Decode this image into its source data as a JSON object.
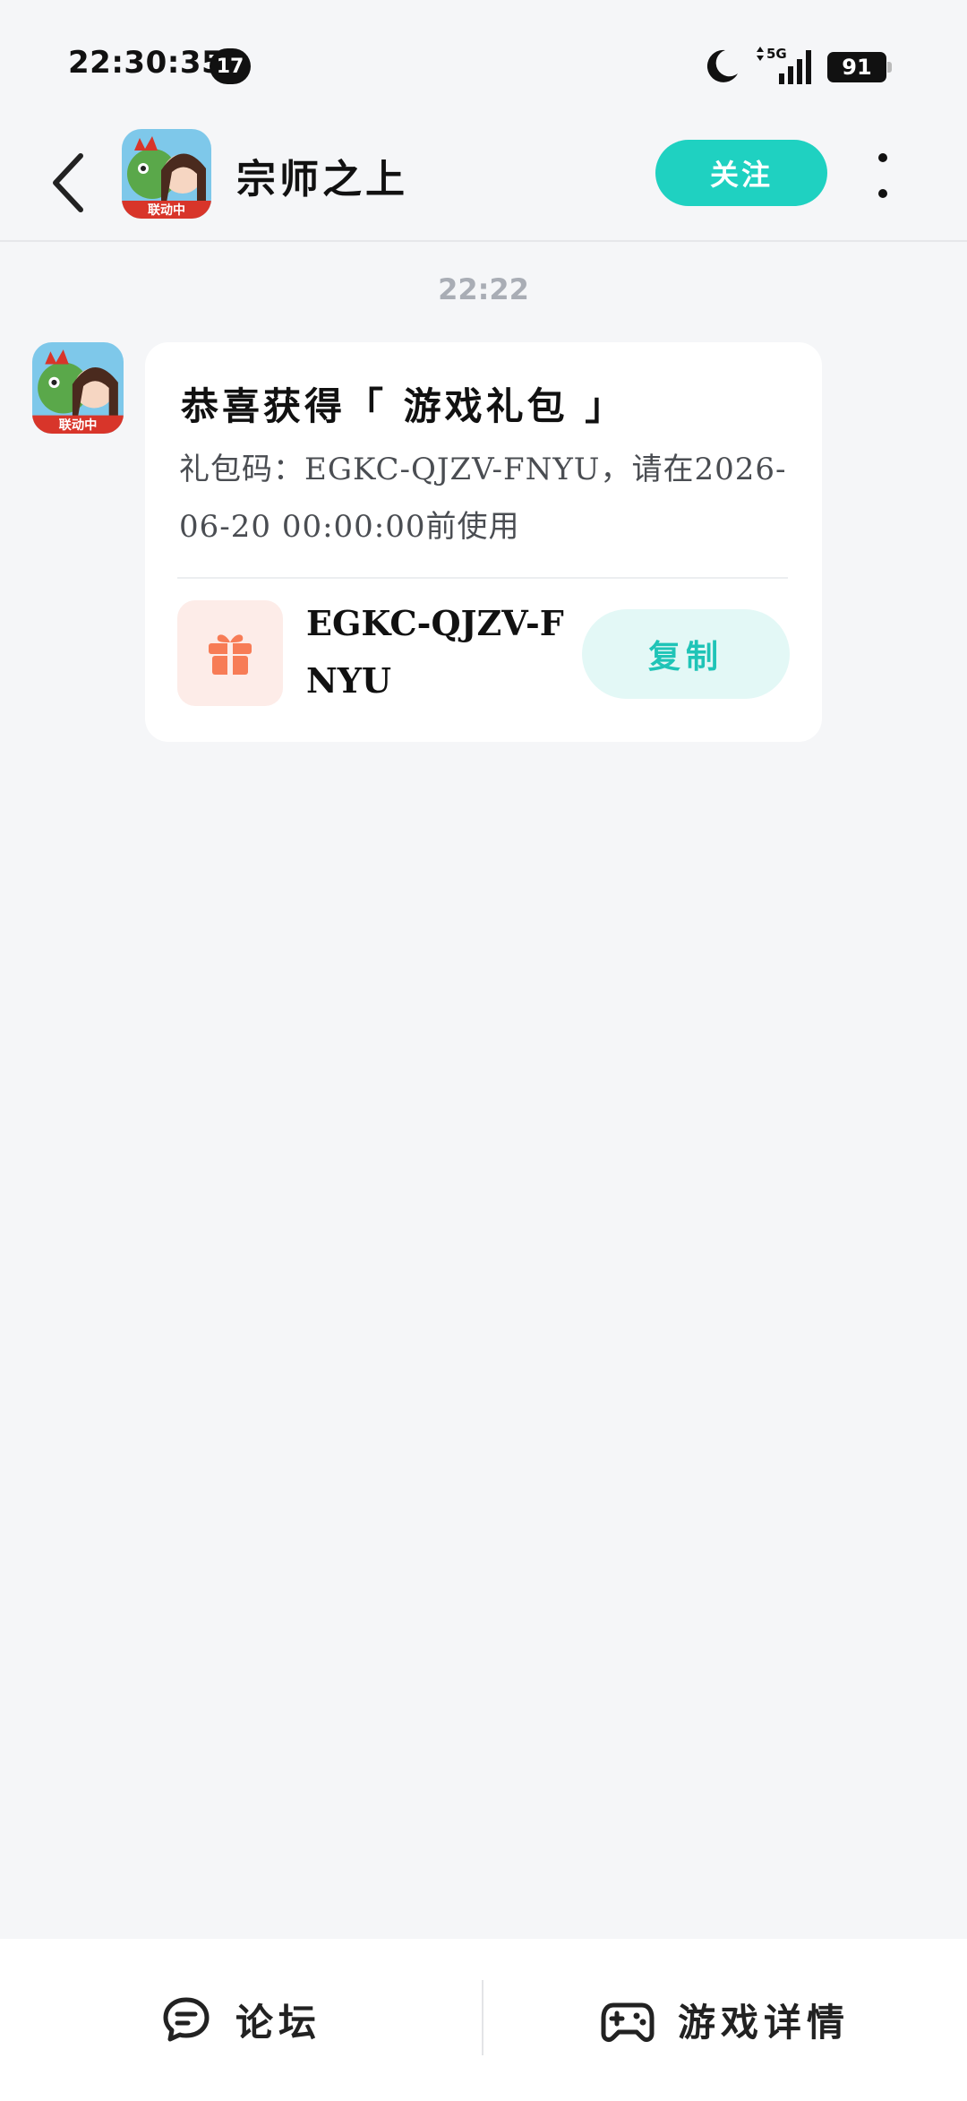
{
  "status_bar": {
    "time": "22:30:35",
    "notification_count": "17",
    "network": "5G",
    "battery": "91"
  },
  "header": {
    "title": "宗师之上",
    "avatar_badge": "联动中",
    "follow_label": "关注"
  },
  "chat": {
    "time": "22:22",
    "message": {
      "title": "恭喜获得「 游戏礼包 」",
      "body": "礼包码：EGKC-QJZV-FNYU，请在2026-06-20 00:00:00前使用",
      "code": "EGKC-QJZV-FNYU",
      "copy_label": "复制"
    }
  },
  "bottom_bar": {
    "forum_label": "论坛",
    "details_label": "游戏详情"
  },
  "colors": {
    "accent": "#1fd1c1",
    "copy_bg": "#e3f8f6",
    "gift_bg": "#fdece8",
    "gift_icon": "#f77c56",
    "page_bg": "#f5f6f8"
  },
  "icons": [
    "moon-icon",
    "signal-icon",
    "battery-icon",
    "back-icon",
    "more-icon",
    "gift-icon",
    "forum-icon",
    "gamepad-icon"
  ]
}
